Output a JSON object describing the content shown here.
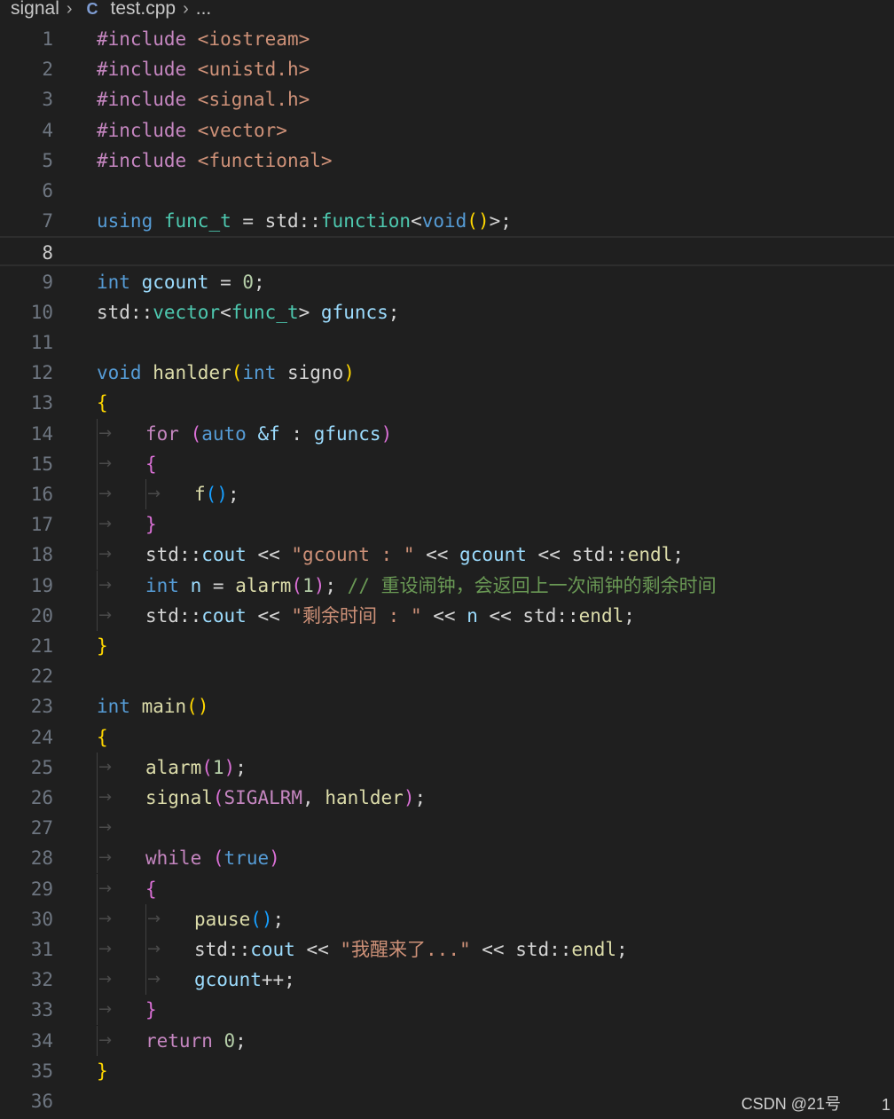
{
  "breadcrumb": {
    "folder": "signal",
    "file_icon": "C",
    "file": "test.cpp",
    "trail": "..."
  },
  "code_lines": [
    {
      "n": "1",
      "tokens": [
        {
          "t": "#include ",
          "c": "pp"
        },
        {
          "t": "<iostream>",
          "c": "str"
        }
      ]
    },
    {
      "n": "2",
      "tokens": [
        {
          "t": "#include ",
          "c": "pp"
        },
        {
          "t": "<unistd.h>",
          "c": "str"
        }
      ]
    },
    {
      "n": "3",
      "tokens": [
        {
          "t": "#include ",
          "c": "pp"
        },
        {
          "t": "<signal.h>",
          "c": "str"
        }
      ]
    },
    {
      "n": "4",
      "tokens": [
        {
          "t": "#include ",
          "c": "pp"
        },
        {
          "t": "<vector>",
          "c": "str"
        }
      ]
    },
    {
      "n": "5",
      "tokens": [
        {
          "t": "#include ",
          "c": "pp"
        },
        {
          "t": "<functional>",
          "c": "str"
        }
      ]
    },
    {
      "n": "6",
      "tokens": []
    },
    {
      "n": "7",
      "tokens": [
        {
          "t": "using",
          "c": "kw"
        },
        {
          "t": " ",
          "c": "ws"
        },
        {
          "t": "func_t",
          "c": "type"
        },
        {
          "t": " = ",
          "c": "op"
        },
        {
          "t": "std",
          "c": "op"
        },
        {
          "t": "::",
          "c": "op"
        },
        {
          "t": "function",
          "c": "type"
        },
        {
          "t": "<",
          "c": "op"
        },
        {
          "t": "void",
          "c": "kw"
        },
        {
          "t": "()",
          "c": "br1"
        },
        {
          "t": ">;",
          "c": "op"
        }
      ]
    },
    {
      "n": "8",
      "tokens": [],
      "current": true
    },
    {
      "n": "9",
      "tokens": [
        {
          "t": "int",
          "c": "kw"
        },
        {
          "t": " ",
          "c": "ws"
        },
        {
          "t": "gcount",
          "c": "id"
        },
        {
          "t": " = ",
          "c": "op"
        },
        {
          "t": "0",
          "c": "num"
        },
        {
          "t": ";",
          "c": "op"
        }
      ]
    },
    {
      "n": "10",
      "tokens": [
        {
          "t": "std",
          "c": "op"
        },
        {
          "t": "::",
          "c": "op"
        },
        {
          "t": "vector",
          "c": "type"
        },
        {
          "t": "<",
          "c": "op"
        },
        {
          "t": "func_t",
          "c": "type"
        },
        {
          "t": "> ",
          "c": "op"
        },
        {
          "t": "gfuncs",
          "c": "id"
        },
        {
          "t": ";",
          "c": "op"
        }
      ]
    },
    {
      "n": "11",
      "tokens": []
    },
    {
      "n": "12",
      "tokens": [
        {
          "t": "void",
          "c": "kw"
        },
        {
          "t": " ",
          "c": "ws"
        },
        {
          "t": "hanlder",
          "c": "fn"
        },
        {
          "t": "(",
          "c": "br1"
        },
        {
          "t": "int",
          "c": "kw"
        },
        {
          "t": " ",
          "c": "ws"
        },
        {
          "t": "signo",
          "c": "op"
        },
        {
          "t": ")",
          "c": "br1"
        }
      ]
    },
    {
      "n": "13",
      "tokens": [
        {
          "t": "{",
          "c": "br1"
        }
      ]
    },
    {
      "n": "14",
      "indent": 1,
      "tokens": [
        {
          "t": "for",
          "c": "ctrl"
        },
        {
          "t": " ",
          "c": "ws"
        },
        {
          "t": "(",
          "c": "br2"
        },
        {
          "t": "auto",
          "c": "kw"
        },
        {
          "t": " ",
          "c": "ws"
        },
        {
          "t": "&f",
          "c": "id"
        },
        {
          "t": " : ",
          "c": "op"
        },
        {
          "t": "gfuncs",
          "c": "id"
        },
        {
          "t": ")",
          "c": "br2"
        }
      ]
    },
    {
      "n": "15",
      "indent": 1,
      "tokens": [
        {
          "t": "{",
          "c": "br2"
        }
      ]
    },
    {
      "n": "16",
      "indent": 2,
      "tokens": [
        {
          "t": "f",
          "c": "fn"
        },
        {
          "t": "()",
          "c": "br3"
        },
        {
          "t": ";",
          "c": "op"
        }
      ]
    },
    {
      "n": "17",
      "indent": 1,
      "tokens": [
        {
          "t": "}",
          "c": "br2"
        }
      ]
    },
    {
      "n": "18",
      "indent": 1,
      "tokens": [
        {
          "t": "std",
          "c": "op"
        },
        {
          "t": "::",
          "c": "op"
        },
        {
          "t": "cout",
          "c": "id"
        },
        {
          "t": " << ",
          "c": "op"
        },
        {
          "t": "\"gcount : \"",
          "c": "str"
        },
        {
          "t": " << ",
          "c": "op"
        },
        {
          "t": "gcount",
          "c": "id"
        },
        {
          "t": " << ",
          "c": "op"
        },
        {
          "t": "std",
          "c": "op"
        },
        {
          "t": "::",
          "c": "op"
        },
        {
          "t": "endl",
          "c": "fn"
        },
        {
          "t": ";",
          "c": "op"
        }
      ]
    },
    {
      "n": "19",
      "indent": 1,
      "tokens": [
        {
          "t": "int",
          "c": "kw"
        },
        {
          "t": " ",
          "c": "ws"
        },
        {
          "t": "n",
          "c": "id"
        },
        {
          "t": " = ",
          "c": "op"
        },
        {
          "t": "alarm",
          "c": "fn"
        },
        {
          "t": "(",
          "c": "br2"
        },
        {
          "t": "1",
          "c": "num"
        },
        {
          "t": ")",
          "c": "br2"
        },
        {
          "t": "; ",
          "c": "op"
        },
        {
          "t": "// 重设闹钟，会返回上一次闹钟的剩余时间",
          "c": "cmt"
        }
      ]
    },
    {
      "n": "20",
      "indent": 1,
      "tokens": [
        {
          "t": "std",
          "c": "op"
        },
        {
          "t": "::",
          "c": "op"
        },
        {
          "t": "cout",
          "c": "id"
        },
        {
          "t": " << ",
          "c": "op"
        },
        {
          "t": "\"剩余时间 : \"",
          "c": "str"
        },
        {
          "t": " << ",
          "c": "op"
        },
        {
          "t": "n",
          "c": "id"
        },
        {
          "t": " << ",
          "c": "op"
        },
        {
          "t": "std",
          "c": "op"
        },
        {
          "t": "::",
          "c": "op"
        },
        {
          "t": "endl",
          "c": "fn"
        },
        {
          "t": ";",
          "c": "op"
        }
      ]
    },
    {
      "n": "21",
      "tokens": [
        {
          "t": "}",
          "c": "br1"
        }
      ]
    },
    {
      "n": "22",
      "tokens": []
    },
    {
      "n": "23",
      "tokens": [
        {
          "t": "int",
          "c": "kw"
        },
        {
          "t": " ",
          "c": "ws"
        },
        {
          "t": "main",
          "c": "fn"
        },
        {
          "t": "()",
          "c": "br1"
        }
      ]
    },
    {
      "n": "24",
      "tokens": [
        {
          "t": "{",
          "c": "br1"
        }
      ]
    },
    {
      "n": "25",
      "indent": 1,
      "tokens": [
        {
          "t": "alarm",
          "c": "fn"
        },
        {
          "t": "(",
          "c": "br2"
        },
        {
          "t": "1",
          "c": "num"
        },
        {
          "t": ")",
          "c": "br2"
        },
        {
          "t": ";",
          "c": "op"
        }
      ]
    },
    {
      "n": "26",
      "indent": 1,
      "tokens": [
        {
          "t": "signal",
          "c": "fn"
        },
        {
          "t": "(",
          "c": "br2"
        },
        {
          "t": "SIGALRM",
          "c": "ctrl"
        },
        {
          "t": ", ",
          "c": "op"
        },
        {
          "t": "hanlder",
          "c": "fn"
        },
        {
          "t": ")",
          "c": "br2"
        },
        {
          "t": ";",
          "c": "op"
        }
      ]
    },
    {
      "n": "27",
      "indent": 1,
      "tokens": []
    },
    {
      "n": "28",
      "indent": 1,
      "tokens": [
        {
          "t": "while",
          "c": "ctrl"
        },
        {
          "t": " ",
          "c": "ws"
        },
        {
          "t": "(",
          "c": "br2"
        },
        {
          "t": "true",
          "c": "kw"
        },
        {
          "t": ")",
          "c": "br2"
        }
      ]
    },
    {
      "n": "29",
      "indent": 1,
      "tokens": [
        {
          "t": "{",
          "c": "br2"
        }
      ]
    },
    {
      "n": "30",
      "indent": 2,
      "tokens": [
        {
          "t": "pause",
          "c": "fn"
        },
        {
          "t": "()",
          "c": "br3"
        },
        {
          "t": ";",
          "c": "op"
        }
      ]
    },
    {
      "n": "31",
      "indent": 2,
      "tokens": [
        {
          "t": "std",
          "c": "op"
        },
        {
          "t": "::",
          "c": "op"
        },
        {
          "t": "cout",
          "c": "id"
        },
        {
          "t": " << ",
          "c": "op"
        },
        {
          "t": "\"我醒来了...\"",
          "c": "str"
        },
        {
          "t": " << ",
          "c": "op"
        },
        {
          "t": "std",
          "c": "op"
        },
        {
          "t": "::",
          "c": "op"
        },
        {
          "t": "endl",
          "c": "fn"
        },
        {
          "t": ";",
          "c": "op"
        }
      ]
    },
    {
      "n": "32",
      "indent": 2,
      "tokens": [
        {
          "t": "gcount",
          "c": "id"
        },
        {
          "t": "++;",
          "c": "op"
        }
      ]
    },
    {
      "n": "33",
      "indent": 1,
      "tokens": [
        {
          "t": "}",
          "c": "br2"
        }
      ]
    },
    {
      "n": "34",
      "indent": 1,
      "tokens": [
        {
          "t": "return",
          "c": "ctrl"
        },
        {
          "t": " ",
          "c": "ws"
        },
        {
          "t": "0",
          "c": "num"
        },
        {
          "t": ";",
          "c": "op"
        }
      ]
    },
    {
      "n": "35",
      "tokens": [
        {
          "t": "}",
          "c": "br1"
        }
      ]
    },
    {
      "n": "36",
      "tokens": []
    }
  ],
  "watermark": {
    "text": "CSDN @21号",
    "right_digit": "1"
  },
  "colors": {
    "background": "#1f1f1f",
    "keyword": "#569cd6",
    "type": "#4ec9b0",
    "function": "#dcdcaa",
    "identifier": "#9cdcfe",
    "string": "#ce9178",
    "comment": "#6a9955",
    "number": "#b5cea8",
    "preprocessor": "#c586c0"
  }
}
